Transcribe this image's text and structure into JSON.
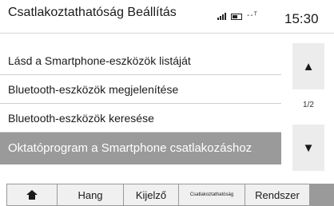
{
  "header": {
    "title": "Csatlakoztathatóság Beállítás",
    "antenna": "--ᵀ",
    "time": "15:30"
  },
  "list": {
    "items": [
      "Lásd a Smartphone-eszközök listáját",
      "Bluetooth-eszközök megjelenítése",
      "Bluetooth-eszközök keresése",
      "Oktatóprogram a Smartphone csatlakozáshoz"
    ],
    "selected_index": 3
  },
  "scroll": {
    "up_icon": "▲",
    "down_icon": "▼",
    "page": "1/2"
  },
  "tabs": {
    "home_icon": "home-icon",
    "items": [
      "Hang",
      "Kijelző",
      "Csatlakoztathatóság",
      "Rendszer"
    ]
  }
}
